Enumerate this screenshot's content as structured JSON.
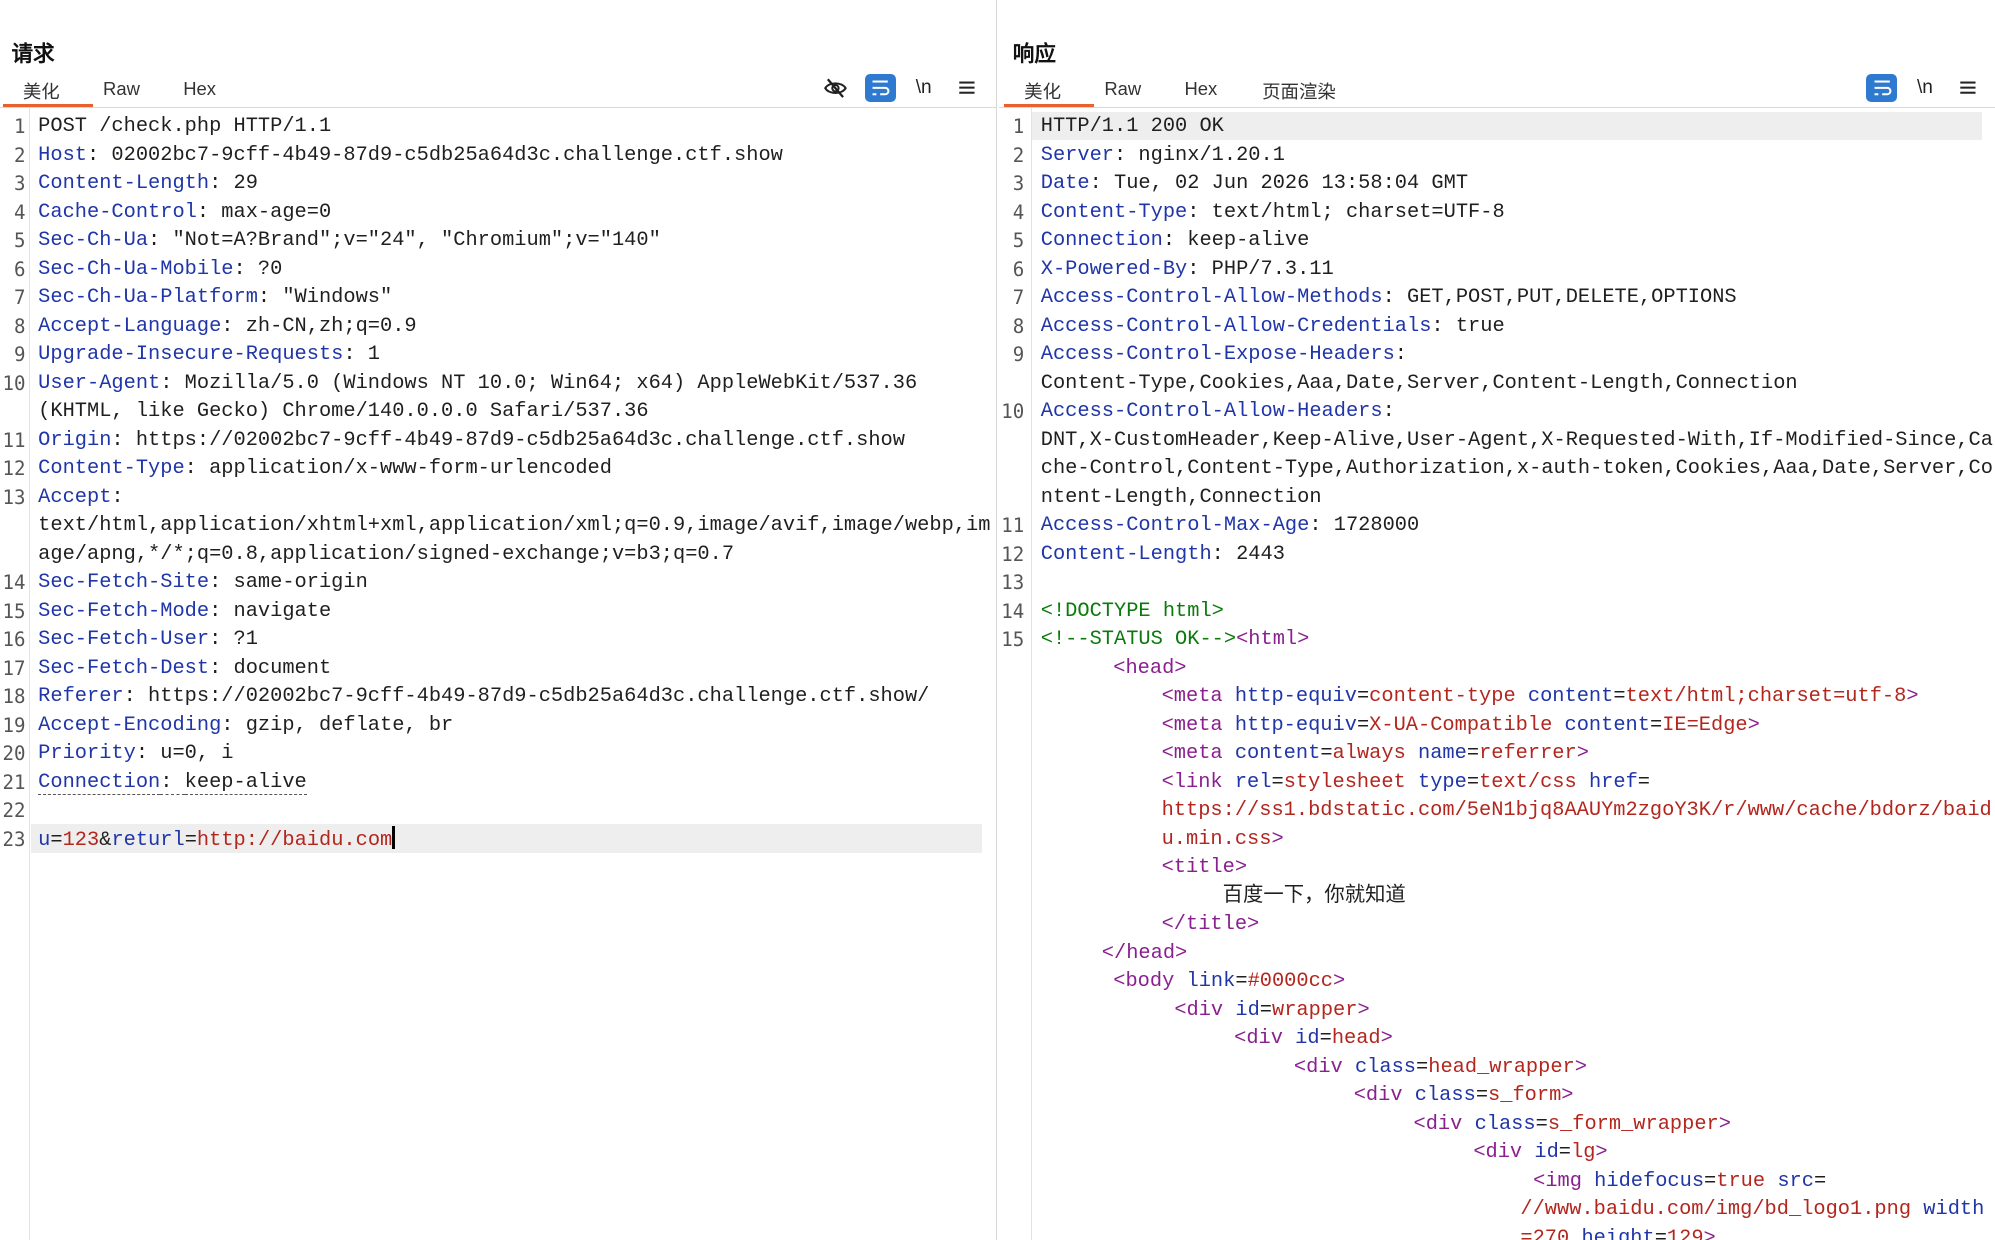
{
  "request": {
    "title": "请求",
    "tabs": [
      "美化",
      "Raw",
      "Hex"
    ],
    "lines": [
      {
        "n": "1",
        "key": "",
        "sep": "",
        "value": "POST /check.php HTTP/1.1"
      },
      {
        "n": "2",
        "key": "Host",
        "sep": ": ",
        "value": "02002bc7-9cff-4b49-87d9-c5db25a64d3c.challenge.ctf.show"
      },
      {
        "n": "3",
        "key": "Content-Length",
        "sep": ": ",
        "value": "29"
      },
      {
        "n": "4",
        "key": "Cache-Control",
        "sep": ": ",
        "value": "max-age=0"
      },
      {
        "n": "5",
        "key": "Sec-Ch-Ua",
        "sep": ": ",
        "value": "\"Not=A?Brand\";v=\"24\", \"Chromium\";v=\"140\""
      },
      {
        "n": "6",
        "key": "Sec-Ch-Ua-Mobile",
        "sep": ": ",
        "value": "?0"
      },
      {
        "n": "7",
        "key": "Sec-Ch-Ua-Platform",
        "sep": ": ",
        "value": "\"Windows\""
      },
      {
        "n": "8",
        "key": "Accept-Language",
        "sep": ": ",
        "value": "zh-CN,zh;q=0.9"
      },
      {
        "n": "9",
        "key": "Upgrade-Insecure-Requests",
        "sep": ": ",
        "value": "1"
      },
      {
        "n": "10",
        "key": "User-Agent",
        "sep": ": ",
        "value": "Mozilla/5.0 (Windows NT 10.0; Win64; x64) AppleWebKit/537.36"
      },
      {
        "n": "",
        "key": "",
        "sep": "",
        "value": "(KHTML, like Gecko) Chrome/140.0.0.0 Safari/537.36"
      },
      {
        "n": "11",
        "key": "Origin",
        "sep": ": ",
        "value": "https://02002bc7-9cff-4b49-87d9-c5db25a64d3c.challenge.ctf.show"
      },
      {
        "n": "12",
        "key": "Content-Type",
        "sep": ": ",
        "value": "application/x-www-form-urlencoded"
      },
      {
        "n": "13",
        "key": "Accept",
        "sep": ":",
        "value": ""
      },
      {
        "n": "",
        "key": "",
        "sep": "",
        "value": "text/html,application/xhtml+xml,application/xml;q=0.9,image/avif,image/webp,im"
      },
      {
        "n": "",
        "key": "",
        "sep": "",
        "value": "age/apng,*/*;q=0.8,application/signed-exchange;v=b3;q=0.7"
      },
      {
        "n": "14",
        "key": "Sec-Fetch-Site",
        "sep": ": ",
        "value": "same-origin"
      },
      {
        "n": "15",
        "key": "Sec-Fetch-Mode",
        "sep": ": ",
        "value": "navigate"
      },
      {
        "n": "16",
        "key": "Sec-Fetch-User",
        "sep": ": ",
        "value": "?1"
      },
      {
        "n": "17",
        "key": "Sec-Fetch-Dest",
        "sep": ": ",
        "value": "document"
      },
      {
        "n": "18",
        "key": "Referer",
        "sep": ": ",
        "value": "https://02002bc7-9cff-4b49-87d9-c5db25a64d3c.challenge.ctf.show/"
      },
      {
        "n": "19",
        "key": "Accept-Encoding",
        "sep": ": ",
        "value": "gzip, deflate, br"
      },
      {
        "n": "20",
        "key": "Priority",
        "sep": ": ",
        "value": "u=0, i"
      },
      {
        "n": "21",
        "key": "Connection",
        "sep": ": ",
        "value": "keep-alive"
      },
      {
        "n": "22",
        "key": "",
        "sep": "",
        "value": ""
      }
    ],
    "body_line": {
      "n": "23",
      "p1": "u",
      "eq1": "=",
      "v1": "123",
      "amp": "&",
      "p2": "returl",
      "eq2": "=",
      "v2": "http://baidu.com"
    }
  },
  "response": {
    "title": "响应",
    "tabs": [
      "美化",
      "Raw",
      "Hex",
      "页面渲染"
    ],
    "header_lines": [
      {
        "n": "1",
        "key": "",
        "sep": "",
        "value": "HTTP/1.1 200 OK"
      },
      {
        "n": "2",
        "key": "Server",
        "sep": ": ",
        "value": "nginx/1.20.1"
      },
      {
        "n": "3",
        "key": "Date",
        "sep": ": ",
        "value": "Tue, 02 Jun 2026 13:58:04 GMT"
      },
      {
        "n": "4",
        "key": "Content-Type",
        "sep": ": ",
        "value": "text/html; charset=UTF-8"
      },
      {
        "n": "5",
        "key": "Connection",
        "sep": ": ",
        "value": "keep-alive"
      },
      {
        "n": "6",
        "key": "X-Powered-By",
        "sep": ": ",
        "value": "PHP/7.3.11"
      },
      {
        "n": "7",
        "key": "Access-Control-Allow-Methods",
        "sep": ": ",
        "value": "GET,POST,PUT,DELETE,OPTIONS"
      },
      {
        "n": "8",
        "key": "Access-Control-Allow-Credentials",
        "sep": ": ",
        "value": "true"
      },
      {
        "n": "9",
        "key": "Access-Control-Expose-Headers",
        "sep": ":",
        "value": ""
      },
      {
        "n": "",
        "key": "",
        "sep": "",
        "value": "Content-Type,Cookies,Aaa,Date,Server,Content-Length,Connection"
      },
      {
        "n": "10",
        "key": "Access-Control-Allow-Headers",
        "sep": ":",
        "value": ""
      },
      {
        "n": "",
        "key": "",
        "sep": "",
        "value": "DNT,X-CustomHeader,Keep-Alive,User-Agent,X-Requested-With,If-Modified-Since,Ca"
      },
      {
        "n": "",
        "key": "",
        "sep": "",
        "value": "che-Control,Content-Type,Authorization,x-auth-token,Cookies,Aaa,Date,Server,Co"
      },
      {
        "n": "",
        "key": "",
        "sep": "",
        "value": "ntent-Length,Connection"
      },
      {
        "n": "11",
        "key": "Access-Control-Max-Age",
        "sep": ": ",
        "value": "1728000"
      },
      {
        "n": "12",
        "key": "Content-Length",
        "sep": ": ",
        "value": "2443"
      },
      {
        "n": "13",
        "key": "",
        "sep": "",
        "value": ""
      }
    ],
    "html_lines": [
      {
        "n": "14",
        "indent": 0,
        "parts": [
          [
            "cmt",
            "<!DOCTYPE html>"
          ]
        ]
      },
      {
        "n": "15",
        "indent": 0,
        "parts": [
          [
            "cmt",
            "<!--STATUS OK-->"
          ],
          [
            "tag",
            "<html>"
          ]
        ]
      },
      {
        "n": "",
        "indent": 57,
        "parts": [
          [
            "tag",
            "<head>"
          ]
        ]
      },
      {
        "n": "",
        "indent": 95,
        "parts": [
          [
            "tag",
            "<meta "
          ],
          [
            "attr",
            "http-equiv"
          ],
          [
            "plain",
            "="
          ],
          [
            "val",
            "content-type"
          ],
          [
            "plain",
            " "
          ],
          [
            "attr",
            "content"
          ],
          [
            "plain",
            "="
          ],
          [
            "val",
            "text/html;charset=utf-8"
          ],
          [
            "tag",
            ">"
          ]
        ]
      },
      {
        "n": "",
        "indent": 95,
        "parts": [
          [
            "tag",
            "<meta "
          ],
          [
            "attr",
            "http-equiv"
          ],
          [
            "plain",
            "="
          ],
          [
            "val",
            "X-UA-Compatible"
          ],
          [
            "plain",
            " "
          ],
          [
            "attr",
            "content"
          ],
          [
            "plain",
            "="
          ],
          [
            "val",
            "IE=Edge"
          ],
          [
            "tag",
            ">"
          ]
        ]
      },
      {
        "n": "",
        "indent": 95,
        "parts": [
          [
            "tag",
            "<meta "
          ],
          [
            "attr",
            "content"
          ],
          [
            "plain",
            "="
          ],
          [
            "val",
            "always"
          ],
          [
            "plain",
            " "
          ],
          [
            "attr",
            "name"
          ],
          [
            "plain",
            "="
          ],
          [
            "val",
            "referrer"
          ],
          [
            "tag",
            ">"
          ]
        ]
      },
      {
        "n": "",
        "indent": 95,
        "parts": [
          [
            "tag",
            "<link "
          ],
          [
            "attr",
            "rel"
          ],
          [
            "plain",
            "="
          ],
          [
            "val",
            "stylesheet"
          ],
          [
            "plain",
            " "
          ],
          [
            "attr",
            "type"
          ],
          [
            "plain",
            "="
          ],
          [
            "val",
            "text/css"
          ],
          [
            "plain",
            " "
          ],
          [
            "attr",
            "href"
          ],
          [
            "plain",
            "="
          ]
        ]
      },
      {
        "n": "",
        "indent": 95,
        "parts": [
          [
            "val",
            "https://ss1.bdstatic.com/5eN1bjq8AAUYm2zgoY3K/r/www/cache/bdorz/baid"
          ]
        ]
      },
      {
        "n": "",
        "indent": 95,
        "parts": [
          [
            "val",
            "u.min.css"
          ],
          [
            "tag",
            ">"
          ]
        ]
      },
      {
        "n": "",
        "indent": 95,
        "parts": [
          [
            "tag",
            "<title>"
          ]
        ]
      },
      {
        "n": "",
        "indent": 143,
        "parts": [
          [
            "plain",
            "百度一下，你就知道"
          ]
        ]
      },
      {
        "n": "",
        "indent": 95,
        "parts": [
          [
            "tag",
            "</title>"
          ]
        ]
      },
      {
        "n": "",
        "indent": 48,
        "parts": [
          [
            "tag",
            "</head>"
          ]
        ]
      },
      {
        "n": "",
        "indent": 57,
        "parts": [
          [
            "tag",
            "<body "
          ],
          [
            "attr",
            "link"
          ],
          [
            "plain",
            "="
          ],
          [
            "val",
            "#0000cc"
          ],
          [
            "tag",
            ">"
          ]
        ]
      },
      {
        "n": "",
        "indent": 105,
        "parts": [
          [
            "tag",
            "<div "
          ],
          [
            "attr",
            "id"
          ],
          [
            "plain",
            "="
          ],
          [
            "val",
            "wrapper"
          ],
          [
            "tag",
            ">"
          ]
        ]
      },
      {
        "n": "",
        "indent": 152,
        "parts": [
          [
            "tag",
            "<div "
          ],
          [
            "attr",
            "id"
          ],
          [
            "plain",
            "="
          ],
          [
            "val",
            "head"
          ],
          [
            "tag",
            ">"
          ]
        ]
      },
      {
        "n": "",
        "indent": 199,
        "parts": [
          [
            "tag",
            "<div "
          ],
          [
            "attr",
            "class"
          ],
          [
            "plain",
            "="
          ],
          [
            "val",
            "head_wrapper"
          ],
          [
            "tag",
            ">"
          ]
        ]
      },
      {
        "n": "",
        "indent": 246,
        "parts": [
          [
            "tag",
            "<div "
          ],
          [
            "attr",
            "class"
          ],
          [
            "plain",
            "="
          ],
          [
            "val",
            "s_form"
          ],
          [
            "tag",
            ">"
          ]
        ]
      },
      {
        "n": "",
        "indent": 293,
        "parts": [
          [
            "tag",
            "<div "
          ],
          [
            "attr",
            "class"
          ],
          [
            "plain",
            "="
          ],
          [
            "val",
            "s_form_wrapper"
          ],
          [
            "tag",
            ">"
          ]
        ]
      },
      {
        "n": "",
        "indent": 340,
        "parts": [
          [
            "tag",
            "<div "
          ],
          [
            "attr",
            "id"
          ],
          [
            "plain",
            "="
          ],
          [
            "val",
            "lg"
          ],
          [
            "tag",
            ">"
          ]
        ]
      },
      {
        "n": "",
        "indent": 387,
        "parts": [
          [
            "tag",
            "<img "
          ],
          [
            "attr",
            "hidefocus"
          ],
          [
            "plain",
            "="
          ],
          [
            "val",
            "true"
          ],
          [
            "plain",
            " "
          ],
          [
            "attr",
            "src"
          ],
          [
            "plain",
            "="
          ]
        ]
      },
      {
        "n": "",
        "indent": 377,
        "parts": [
          [
            "val",
            "//www.baidu.com/img/bd_logo1.png"
          ],
          [
            "plain",
            " "
          ],
          [
            "attr",
            "width"
          ]
        ]
      },
      {
        "n": "",
        "indent": 377,
        "parts": [
          [
            "val",
            "=270"
          ],
          [
            "plain",
            " "
          ],
          [
            "attr",
            "height"
          ],
          [
            "plain",
            "="
          ],
          [
            "val",
            "129"
          ],
          [
            "tag",
            ">"
          ]
        ]
      }
    ]
  },
  "icons": {
    "hide": "eye-slash-icon",
    "wrap": "word-wrap-icon",
    "newline": "\\n",
    "menu": "menu-icon"
  },
  "colors": {
    "accent": "#e8602c",
    "toggle": "#2f7ad1",
    "header_key": "#1f35a8",
    "string": "#b3261e",
    "tag": "#8a1f8f",
    "comment": "#0b7a0b"
  }
}
